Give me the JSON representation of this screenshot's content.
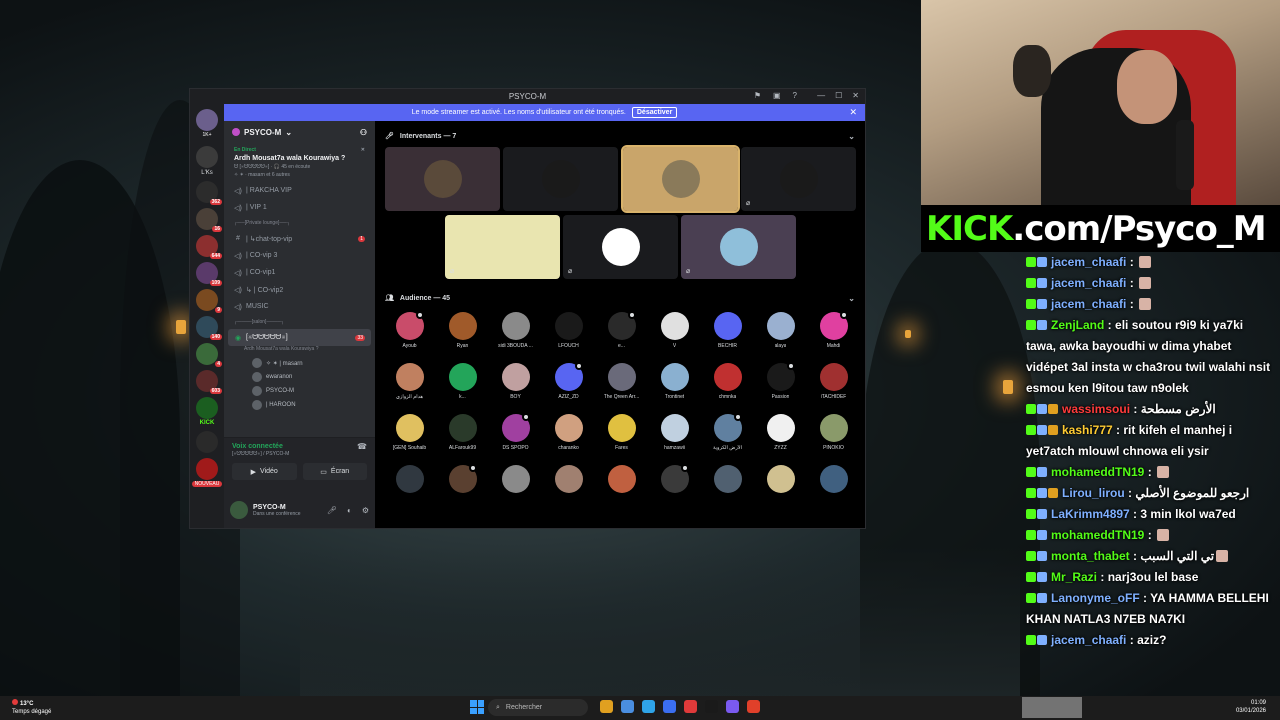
{
  "discord": {
    "window_title": "PSYCO-M",
    "banner": {
      "text": "Le mode streamer est activé. Les noms d'utilisateur ont été tronqués.",
      "button": "Désactiver"
    },
    "server_name": "PSYCO-M",
    "servers": [
      {
        "color": "#6b5f8c",
        "badge": ""
      },
      {
        "color": "#3b3b3b",
        "badge": ""
      },
      {
        "color": "#2c2c2c",
        "badge": "362"
      },
      {
        "color": "#4a4038",
        "badge": "16"
      },
      {
        "color": "#8c2f2f",
        "badge": "644"
      },
      {
        "color": "#5a3a6a",
        "badge": "109"
      },
      {
        "color": "#7a4a20",
        "badge": "9"
      },
      {
        "color": "#2f4a5a",
        "badge": "140"
      },
      {
        "color": "#3a6a3a",
        "badge": "4"
      },
      {
        "color": "#5a2a2a",
        "badge": "603"
      },
      {
        "color": "#1b5e20",
        "badge": ""
      },
      {
        "color": "#2a2a2a",
        "badge": ""
      },
      {
        "color": "#a01a1a",
        "badge": ""
      }
    ],
    "server_labels": {
      "top_badge": "1K+",
      "lks": "L'Ks",
      "kick": "KICK",
      "nouveau": "NOUVEAU"
    },
    "live": {
      "status": "En Direct",
      "title": "Ardh Mousat7a wala Kourawiya ?",
      "meta": "ᗢ [※ᗢᗢᗢᗢᗢ※] · 🎧 45 en écoute",
      "meta2": "✧ ✶ · masarn et 6 autres"
    },
    "channels": [
      {
        "icon": "🔊",
        "label": "| RAKCHA VIP",
        "type": "voice"
      },
      {
        "icon": "🔊",
        "label": "| VIP 1",
        "type": "voice"
      },
      {
        "icon": "",
        "label": "┌──[Private lounge]──┐",
        "type": "category"
      },
      {
        "icon": "#",
        "label": "| ↳chat-top-vip",
        "type": "text",
        "unread": "1"
      },
      {
        "icon": "🔊",
        "label": "| CO-vip 3",
        "type": "voice"
      },
      {
        "icon": "🔊",
        "label": "| CO-vip1",
        "type": "voice"
      },
      {
        "icon": "🔊",
        "label": "↳ | CO-vip2",
        "type": "voice"
      },
      {
        "icon": "🔊",
        "label": "MUSIC",
        "type": "voice"
      },
      {
        "icon": "",
        "label": "┌────[salon]────┐",
        "type": "category"
      }
    ],
    "active_channel": {
      "label": "[※ᗢᗢᗢᗢᗢ※]",
      "sub": "Ardh Mousat7a wala Kourawiya ?",
      "unread": "33"
    },
    "members": [
      "✧ ✶ | masarn",
      "ewaranon",
      "PSYCO-M",
      "| HAROON"
    ],
    "voice": {
      "status": "Voix connectée",
      "sub": "[※ᗢᗢᗢᗢᗢ※] / PSYCO-M",
      "video_label": "Vidéo",
      "screen_label": "Écran"
    },
    "user": {
      "name": "PSYCO-M",
      "status": "Dans une conférence"
    },
    "speakers_header": "Intervenants — 7",
    "speakers": [
      {
        "color": "#5a4a3a",
        "border": ""
      },
      {
        "color": "#1a1a1a",
        "border": ""
      },
      {
        "color": "#8a7a5a",
        "border": "#d9b36b"
      },
      {
        "color": "#1a1a1a",
        "border": ""
      },
      {
        "color": "#e9e5b0",
        "border": ""
      },
      {
        "color": "#ffffff",
        "border": ""
      },
      {
        "color": "#8fbfda",
        "border": ""
      }
    ],
    "audience_header": "Audience — 45",
    "audience": [
      {
        "name": "Ayoub",
        "color": "#c94c6a"
      },
      {
        "name": "Ryan",
        "color": "#a05a2a"
      },
      {
        "name": "sidi 3BOUDA ...",
        "color": "#8a8a8a"
      },
      {
        "name": "LFOUCH",
        "color": "#1a1a1a"
      },
      {
        "name": "e...",
        "color": "#2a2a2a"
      },
      {
        "name": "V",
        "color": "#e0e0e0"
      },
      {
        "name": "BECHIR",
        "color": "#5865f2"
      },
      {
        "name": "alaya",
        "color": "#9ab0d0"
      },
      {
        "name": "Mahdi",
        "color": "#e040a0"
      },
      {
        "name": "هدام الزوازي",
        "color": "#c08060"
      },
      {
        "name": "k...",
        "color": "#23a55a"
      },
      {
        "name": "BOY",
        "color": "#c0a0a0"
      },
      {
        "name": "AZIZ_ZD",
        "color": "#5865f2"
      },
      {
        "name": "The Qreen Arr...",
        "color": "#6a6a7a"
      },
      {
        "name": "Trontinet",
        "color": "#8ab0d0"
      },
      {
        "name": "chmnka",
        "color": "#c03030"
      },
      {
        "name": "Passion",
        "color": "#1a1a1a"
      },
      {
        "name": "iTACHIDEF",
        "color": "#a03030"
      },
      {
        "name": "[GEN] Souhaib",
        "color": "#e0c060"
      },
      {
        "name": "ALFarouk99",
        "color": "#2a3a2a"
      },
      {
        "name": "DS SPOPO",
        "color": "#a040a0"
      },
      {
        "name": "charanko",
        "color": "#d0a080"
      },
      {
        "name": "Fares",
        "color": "#e0c040"
      },
      {
        "name": "hamzawii",
        "color": "#c0d0e0"
      },
      {
        "name": "الأرض الكروية",
        "color": "#6080a0"
      },
      {
        "name": "ZYZZ",
        "color": "#f0f0f0"
      },
      {
        "name": "PINOKIO",
        "color": "#8a9a6a"
      },
      {
        "name": "",
        "color": "#303840"
      },
      {
        "name": "",
        "color": "#5a4030"
      },
      {
        "name": "",
        "color": "#8a8a8a"
      },
      {
        "name": "",
        "color": "#a08070"
      },
      {
        "name": "",
        "color": "#c06040"
      },
      {
        "name": "",
        "color": "#3a3a3a"
      },
      {
        "name": "",
        "color": "#506070"
      },
      {
        "name": "",
        "color": "#d0c090"
      },
      {
        "name": "",
        "color": "#406080"
      }
    ]
  },
  "overlay": {
    "kick_green": "KICK",
    "kick_white": ".com/Psyco_M"
  },
  "chat": [
    {
      "user": "jacem_chaafi",
      "color": "#7fb0ff",
      "text": "",
      "emote": true
    },
    {
      "user": "jacem_chaafi",
      "color": "#7fb0ff",
      "text": "",
      "emote": true
    },
    {
      "user": "jacem_chaafi",
      "color": "#7fb0ff",
      "text": "",
      "emote": true
    },
    {
      "user": "ZenjLand",
      "color": "#53fc18",
      "text": "eli soutou r9i9 ki ya7ki tawa, awka bayoudhi w dima yhabet vidépet 3al insta w cha3rou twil walahi nsit esmou ken l9itou taw n9olek",
      "emote": false
    },
    {
      "user": "wassimsoui",
      "color": "#ff3b3b",
      "text": "الأرض مسطحة",
      "emote": false
    },
    {
      "user": "kashi777",
      "color": "#ffcc33",
      "text": "rit kifeh el manhej i yet7atch mlouwl chnowa eli ysir",
      "emote": false
    },
    {
      "user": "mohameddTN19",
      "color": "#53fc18",
      "text": "",
      "emote": true
    },
    {
      "user": "Lirou_lirou",
      "color": "#7fb0ff",
      "text": "ارجعو للموضوع الأصلي",
      "emote": false
    },
    {
      "user": "LaKrimm4897",
      "color": "#7fb0ff",
      "text": "3 min lkol wa7ed",
      "emote": false
    },
    {
      "user": "mohameddTN19",
      "color": "#53fc18",
      "text": "",
      "emote": true
    },
    {
      "user": "monta_thabet",
      "color": "#53fc18",
      "text": "تي التي السبب",
      "emote": true
    },
    {
      "user": "Mr_Razi",
      "color": "#53fc18",
      "text": "narj3ou lel base",
      "emote": false
    },
    {
      "user": "Lanonyme_oFF",
      "color": "#7fb0ff",
      "text": "YA HAMMA BELLEHI KHAN NATLA3 N7EB NA7KI",
      "emote": false
    },
    {
      "user": "jacem_chaafi",
      "color": "#7fb0ff",
      "text": "aziz?",
      "emote": false
    }
  ],
  "taskbar": {
    "temp": "13°C",
    "weather": "Temps dégagé",
    "search_placeholder": "Rechercher",
    "time": "01:09",
    "date": "03/01/2026",
    "app_colors": [
      "#e0a020",
      "#4a8ee0",
      "#2fa4e8",
      "#3b6ef0",
      "#e03a3a",
      "#1a1a1a",
      "#7a5af0",
      "#e0402a"
    ]
  }
}
